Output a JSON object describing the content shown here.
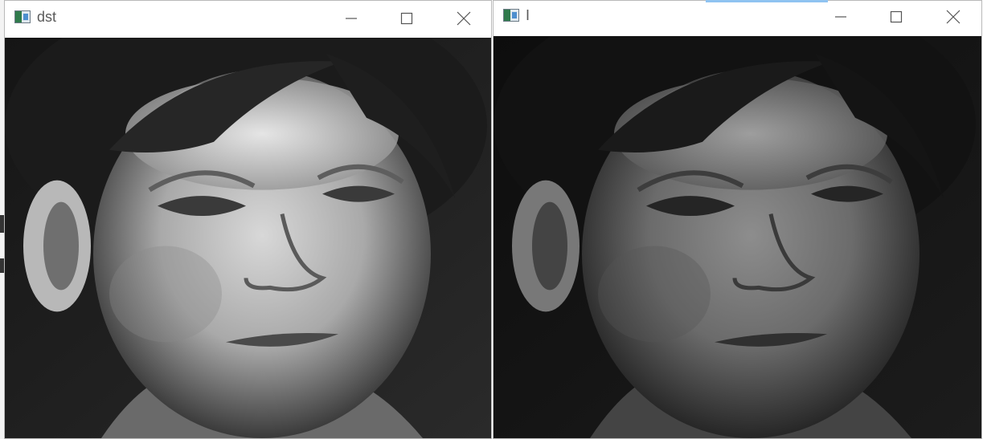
{
  "windows": [
    {
      "title": "dst",
      "controls": {
        "minimize": "minimize-icon",
        "maximize": "maximize-icon",
        "close": "close-icon"
      },
      "image": {
        "content": "grayscale-portrait",
        "tone": "high-contrast"
      }
    },
    {
      "title": "I",
      "controls": {
        "minimize": "minimize-icon",
        "maximize": "maximize-icon",
        "close": "close-icon"
      },
      "image": {
        "content": "grayscale-portrait",
        "tone": "original"
      }
    }
  ],
  "colors": {
    "title_text": "#5a5a5a",
    "window_border": "#b9b9b9",
    "accent": "#8fc3f1"
  }
}
